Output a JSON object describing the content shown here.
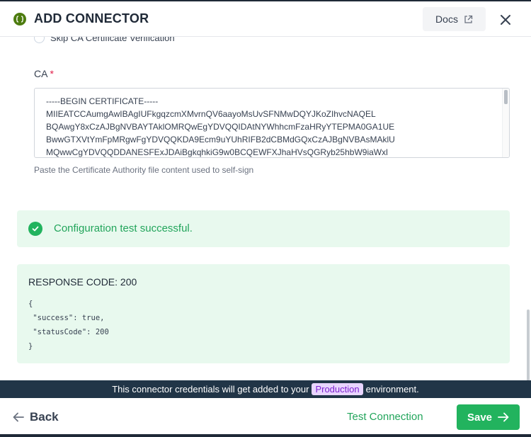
{
  "header": {
    "title": "ADD CONNECTOR",
    "docs_label": "Docs",
    "icons": {
      "logo": "connector-logo-icon",
      "external": "external-link-icon",
      "close": "close-icon"
    }
  },
  "form": {
    "skip_ca_label": "Skip CA Certificate Verification",
    "ca_label": "CA",
    "ca_required_marker": "*",
    "ca_lines": [
      "-----BEGIN CERTIFICATE-----",
      "MIIEATCCAumgAwIBAgIUFkgqzcmXMvrnQV6aayoMsUvSFNMwDQYJKoZIhvcNAQEL",
      "BQAwgY8xCzAJBgNVBAYTAklOMRQwEgYDVQQIDAtNYWhhcmFzaHRyYTEPMA0GA1UE",
      "BwwGTXVtYmFpMRgwFgYDVQQKDA9Ecm9uYUhRIFB2dCBMdGQxCzAJBgNVBAsMAklU",
      "MQwwCgYDVQQDDANESFExJDAiBgkqhkiG9w0BCQEWFXJhaHVsQGRyb25hbW9iaWxl"
    ],
    "ca_hint": "Paste the Certificate Authority file content used to self-sign"
  },
  "test_result": {
    "message": "Configuration test successful.",
    "status_color": "#22b35e"
  },
  "response": {
    "title": "RESPONSE CODE: 200",
    "body_lines": [
      "{",
      " \"success\": true,",
      " \"statusCode\": 200",
      "}"
    ]
  },
  "banner": {
    "prefix": "This connector credentials will get added to your",
    "environment": "Production",
    "suffix": "environment."
  },
  "footer": {
    "back_label": "Back",
    "test_label": "Test Connection",
    "save_label": "Save"
  }
}
